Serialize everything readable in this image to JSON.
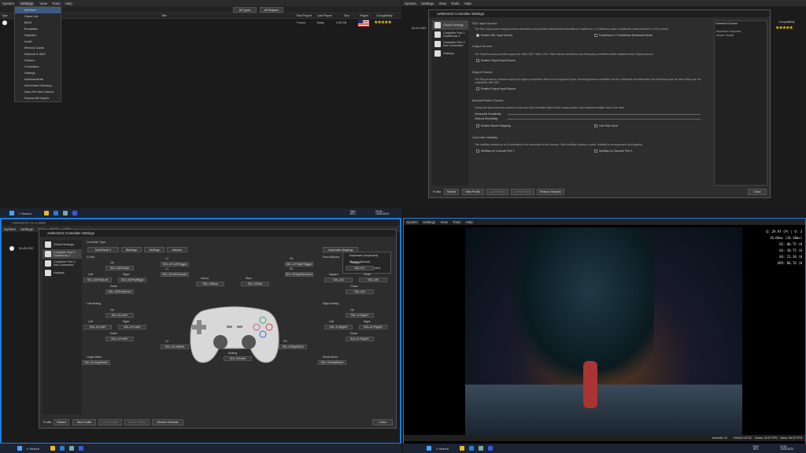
{
  "tl": {
    "menus": [
      "System",
      "Settings",
      "View",
      "Tools",
      "Help"
    ],
    "dropdown_items": [
      "Interface",
      "Game List",
      "BIOS",
      "Emulation",
      "Graphics",
      "Audio",
      "Memory Cards",
      "Network & HDD",
      "Folders",
      "Controllers",
      "Hotkeys",
      "Achievements",
      "Add Game Directory...",
      "Scan For New Games",
      "Rescan All Games"
    ],
    "filter_types": "All Types",
    "filter_regions": "All Regions",
    "cols": [
      "Title",
      "Time Played",
      "Last Played",
      "Size",
      "Region",
      "Compatibility"
    ],
    "row": {
      "type": " ",
      "played": "7 hours",
      "last": "Today",
      "size": "4.09 GB",
      "stars": "★★★★★"
    },
    "side_code": "Type"
  },
  "tr": {
    "title": "AetherSX2 Controller Settings",
    "sidebar": [
      "Global Settings",
      "Controller Port 1\nDualShock 2",
      "Controller Port 2\nNot Connected",
      "Hotkeys"
    ],
    "list_id": "SLUS-2057",
    "stars": "★★★★★",
    "col_compat": "Compatibility",
    "sections": {
      "sdl": "SDL Input Source",
      "sdl_desc": "The SDL input source supports most controllers, and provides advanced functionality for DualShock 4 / DualSense pads in Bluetooth mode (Vibration / LED Control).",
      "sdl_chk1": "Enable SDL Input Source",
      "sdl_chk2": "DualShock 4 / DualSense Enhanced Mode",
      "xinput": "XInput Source",
      "xinput_desc": "The XInput source provides support for XBox 360 / XBox One / XBox Series controllers, and third party controllers which implement the XInput protocol.",
      "xinput_chk": "Enable XInput Input Source",
      "dinput": "DInput Source",
      "dinput_desc": "The DInput source provides support for legacy controllers which do not support XInput. Accessing these controllers via SDL instead is recommended, but DirectInput can be used if they are not compatible with SDL.",
      "dinput_chk": "Enable DInput Input Source",
      "mouse": "Mouse/Pointer Source",
      "mouse_desc": "Using raw input improves precision when you bind controller sticks to the mouse pointer. Also enables multiple mice to be used.",
      "hsens": "Horizontal Sensitivity:",
      "vsens": "Vertical Sensitivity:",
      "mouse_chk1": "Enable Mouse Mapping",
      "mouse_chk2": "Use Raw Input",
      "multitap": "Controller Multitap",
      "multitap_desc": "The multitap enables up to 8 controllers to be connected to the console. Each multitap provides 4 ports. Multitap is not supported by all games.",
      "mt_chk1": "Multitap on Console Port 1",
      "mt_chk2": "Multitap on Console Port 2"
    },
    "detected_title": "Detected Devices",
    "detected": [
      "Keyboard: Keyboard",
      "Mouse: Mouse"
    ],
    "profile_label": "Profile:",
    "profile_value": "Shared",
    "footer_btns": [
      "New Profile",
      "Load Profile",
      "Delete Profile",
      "Restore Defaults"
    ],
    "close": "Close"
  },
  "bl": {
    "win_title": "AetherSX2 v1.5-3606",
    "title": "AetherSX2 Controller Settings",
    "menus": [
      "System",
      "Settings",
      "View",
      "Tools",
      "Help"
    ],
    "sidebar": [
      "Global Settings",
      "Controller Port 1\nDualShock 2",
      "Controller Port 2\nNot Connected",
      "Hotkeys"
    ],
    "list_id": "SLUS-2057",
    "controller_type_label": "Controller Type",
    "controller_type": "DualShock 2",
    "tabs": [
      "Bindings",
      "Settings",
      "Macros"
    ],
    "automatic": "Automatic Mapping",
    "popup": [
      "Keyboard (Keyboard)",
      "Mouse (Mouse)",
      "SDL-0 (DS4 Controller)"
    ],
    "bind_labels": {
      "dpad": "D-Pad",
      "up": "Up",
      "left": "Left",
      "right": "Right",
      "down": "Down",
      "l2": "L2",
      "r2": "R2",
      "l1": "L1",
      "r1": "R1",
      "select": "Select",
      "start": "Start",
      "face": "Face Buttons",
      "triangle": "Triangle",
      "square": "Square",
      "circle": "Circle",
      "cross": "Cross",
      "lanalog": "Left Analog",
      "ranalog": "Right Analog",
      "lup": "Up",
      "lleft": "Left",
      "lright": "Right",
      "ldown": "Down",
      "rup": "Up",
      "rleft": "Left",
      "rright": "Right",
      "rdown": "Down",
      "l3": "L3",
      "r3": "R3",
      "pressure": "Pressure Modifier",
      "analog": "Analog",
      "lmotor": "Large Motor",
      "smotor": "Small Motor"
    },
    "bind_values": {
      "up": "SDL-0/DPadUp",
      "left": "SDL-0/DPadLeft",
      "right": "SDL-0/DPadRight",
      "down": "SDL-0/DPadDown",
      "l2": "SDL-0/+LeftTrigger",
      "r2": "SDL-0/+RightTrigger",
      "l1": "SDL-0/LeftShoulder",
      "r1": "SDL-0/RightShoulder",
      "select": "SDL-0/Back",
      "start": "SDL-0/Start",
      "triangle": "SDL-0/Y",
      "square": "SDL-0/X",
      "circle": "SDL-0/B",
      "cross": "SDL-0/A",
      "lup": "SDL-0/-LeftY",
      "lleft": "SDL-0/-LeftX",
      "lright": "SDL-0/+LeftX",
      "ldown": "SDL-0/+LeftY",
      "rup": "SDL-0/-RightY",
      "rleft": "SDL-0/-RightX",
      "rright": "SDL-0/+RightX",
      "rdown": "SDL-0/+RightY",
      "l3": "SDL-0/LeftStick",
      "pressure": "",
      "r3": "SDL-0/RightStick",
      "analog": "SDL-0/Guide",
      "lmotor": "SDL-0/LargeMotor",
      "smotor": "SDL-0/SmallMotor"
    },
    "profile_label": "Profile:",
    "profile_value": "Shared",
    "footer_btns": [
      "New Profile",
      "Load Profile",
      "Delete Profile",
      "Restore Defaults"
    ],
    "close": "Close"
  },
  "br": {
    "menus": [
      "System",
      "Settings",
      "View",
      "Tools",
      "Help"
    ],
    "osd": [
      "Q: 29.97 (P) | V: 3",
      "16.66ms (16.10ms)",
      "EE: 06.75 (0",
      "GS: 20.75 (0",
      "VU: 21.20 (0",
      "GPU: 06.76 (0"
    ],
    "status": [
      "Direct3D 12",
      "720x512 NTSC",
      "Game: 29.97 FPS",
      "Video: 59.97 FPS"
    ]
  },
  "taskbar": {
    "search": "Search",
    "lang": "ENG\nINTL",
    "time_l": "18:25\n14/01/2023",
    "time_r": "18:54\n14/01/2023"
  },
  "colors": {
    "accent": "#1e7be0",
    "bg": "#1b1b1b",
    "dialog": "#2d2d2d",
    "star": "#ffcc00"
  }
}
